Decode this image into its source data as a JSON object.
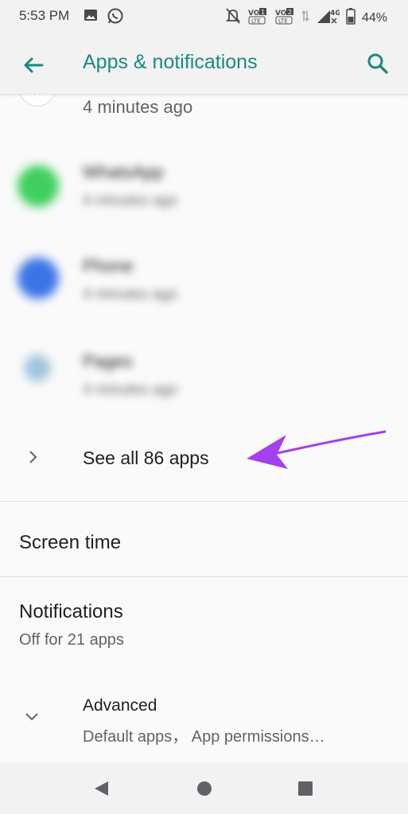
{
  "status_bar": {
    "time": "5:53 PM",
    "left_icons": [
      "gallery-icon",
      "whatsapp-icon"
    ],
    "right_icons": [
      "mute-icon",
      "volte-1-icon",
      "volte-2-icon",
      "data-arrows-icon",
      "signal-4g-icon",
      "battery-icon"
    ],
    "battery_percent": "44%"
  },
  "app_bar": {
    "title": "Apps & notifications",
    "back_icon": "arrow-back-icon",
    "search_icon": "search-icon",
    "accent_color": "#1a8a7e"
  },
  "recent_apps": {
    "partial_item_time": "4 minutes ago",
    "items": [
      {
        "name": "WhatsApp",
        "subtitle": "4 minutes ago",
        "icon_color": "#3ecf5c"
      },
      {
        "name": "Phone",
        "subtitle": "4 minutes ago",
        "icon_color": "#3b74e6"
      },
      {
        "name": "Pages",
        "subtitle": "4 minutes ago",
        "icon_color": "#9fc6dc"
      }
    ]
  },
  "see_all": {
    "label": "See all 86 apps",
    "annotation_arrow_color": "#a340ef"
  },
  "preferences": {
    "screen_time": {
      "title": "Screen time"
    },
    "notifications": {
      "title": "Notifications",
      "subtitle": "Off for 21 apps"
    },
    "advanced": {
      "title": "Advanced",
      "subtitle": "Default apps， App permissions…"
    }
  },
  "nav_bar": {
    "buttons": [
      "nav-back-icon",
      "nav-home-icon",
      "nav-recents-icon"
    ]
  }
}
